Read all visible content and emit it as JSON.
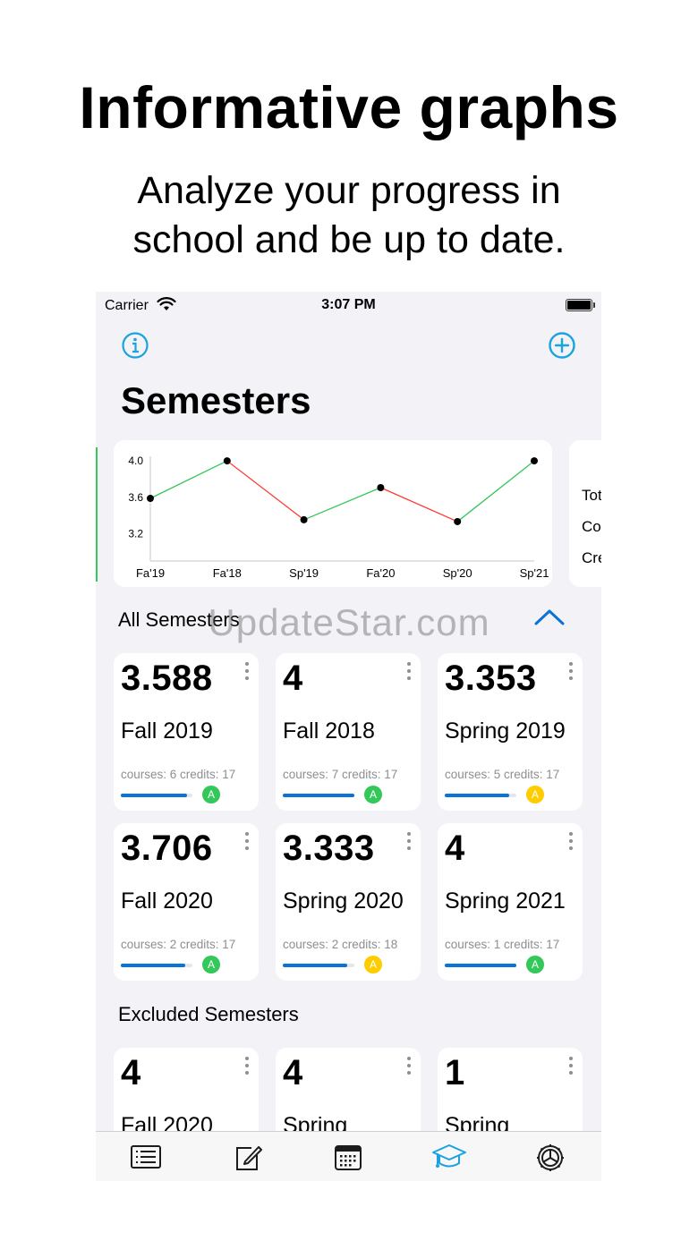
{
  "promo": {
    "headline": "Informative graphs",
    "subline_1": "Analyze your progress in",
    "subline_2": "school and be up to date."
  },
  "status_bar": {
    "carrier": "Carrier",
    "time": "3:07 PM"
  },
  "page": {
    "title": "Semesters"
  },
  "colors": {
    "accent": "#1aa3e0",
    "up_line": "#34c759",
    "down_line": "#ff3b30",
    "progress": "#0a72d8",
    "grade_green": "#34c759",
    "grade_yellow": "#ffcc00"
  },
  "chart_data": {
    "type": "line",
    "x": [
      "Fa'19",
      "Fa'18",
      "Sp'19",
      "Fa'20",
      "Sp'20",
      "Sp'21"
    ],
    "values": [
      3.588,
      4.0,
      3.353,
      3.706,
      3.333,
      4.0
    ],
    "yticks": [
      "4.0",
      "3.6",
      "3.2"
    ],
    "ytick_values": [
      4.0,
      3.6,
      3.2
    ],
    "ylim": [
      2.9,
      4.05
    ],
    "legend": "none",
    "grid": false
  },
  "stats_peek": [
    "Tot",
    "Co",
    "Cre"
  ],
  "sections": {
    "all": "All Semesters",
    "excluded": "Excluded Semesters"
  },
  "watermark": "UpdateStar.com",
  "all_semesters": [
    {
      "gpa": "3.588",
      "name": "Fall 2019",
      "meta": "courses: 6 credits: 17",
      "progress": 0.92,
      "grade": "A",
      "grade_color": "green"
    },
    {
      "gpa": "4",
      "name": "Fall 2018",
      "meta": "courses: 7 credits: 17",
      "progress": 1.0,
      "grade": "A",
      "grade_color": "green"
    },
    {
      "gpa": "3.353",
      "name": "Spring 2019",
      "meta": "courses: 5 credits: 17",
      "progress": 0.9,
      "grade": "A",
      "grade_color": "yellow"
    },
    {
      "gpa": "3.706",
      "name": "Fall 2020",
      "meta": "courses: 2 credits: 17",
      "progress": 0.9,
      "grade": "A",
      "grade_color": "green"
    },
    {
      "gpa": "3.333",
      "name": "Spring 2020",
      "meta": "courses: 2 credits: 18",
      "progress": 0.9,
      "grade": "A",
      "grade_color": "yellow"
    },
    {
      "gpa": "4",
      "name": "Spring 2021",
      "meta": "courses: 1 credits: 17",
      "progress": 1.0,
      "grade": "A",
      "grade_color": "green"
    }
  ],
  "excluded_semesters": [
    {
      "gpa": "4",
      "name": "Fall 2020"
    },
    {
      "gpa": "4",
      "name": "Spring"
    },
    {
      "gpa": "1",
      "name": "Spring"
    }
  ],
  "tabs": [
    {
      "icon": "list-icon",
      "active": false
    },
    {
      "icon": "edit-icon",
      "active": false
    },
    {
      "icon": "calendar-icon",
      "active": false
    },
    {
      "icon": "graduation-cap-icon",
      "active": true
    },
    {
      "icon": "gear-icon",
      "active": false
    }
  ]
}
